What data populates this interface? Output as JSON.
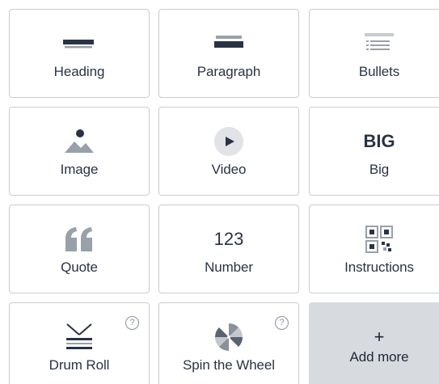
{
  "tiles": [
    {
      "id": "heading",
      "label": "Heading",
      "icon": "heading-icon"
    },
    {
      "id": "paragraph",
      "label": "Paragraph",
      "icon": "paragraph-icon"
    },
    {
      "id": "bullets",
      "label": "Bullets",
      "icon": "bullets-icon"
    },
    {
      "id": "image",
      "label": "Image",
      "icon": "image-icon"
    },
    {
      "id": "video",
      "label": "Video",
      "icon": "play-icon"
    },
    {
      "id": "big",
      "label": "Big",
      "icon_text": "BIG"
    },
    {
      "id": "quote",
      "label": "Quote",
      "icon": "quote-icon"
    },
    {
      "id": "number",
      "label": "Number",
      "icon_text": "123"
    },
    {
      "id": "instructions",
      "label": "Instructions",
      "icon": "qr-code-icon"
    },
    {
      "id": "drum-roll",
      "label": "Drum Roll",
      "icon": "drum-icon",
      "help": "?"
    },
    {
      "id": "spin-the-wheel",
      "label": "Spin the Wheel",
      "icon": "wheel-icon",
      "help": "?"
    }
  ],
  "add_more": {
    "plus": "+",
    "label": "Add more"
  },
  "colors": {
    "text": "#2a3344",
    "icon": "#2a3344",
    "icon_light": "#9aa0aa",
    "border": "#c9cbd1",
    "add_more_bg": "#d7dbe0"
  }
}
